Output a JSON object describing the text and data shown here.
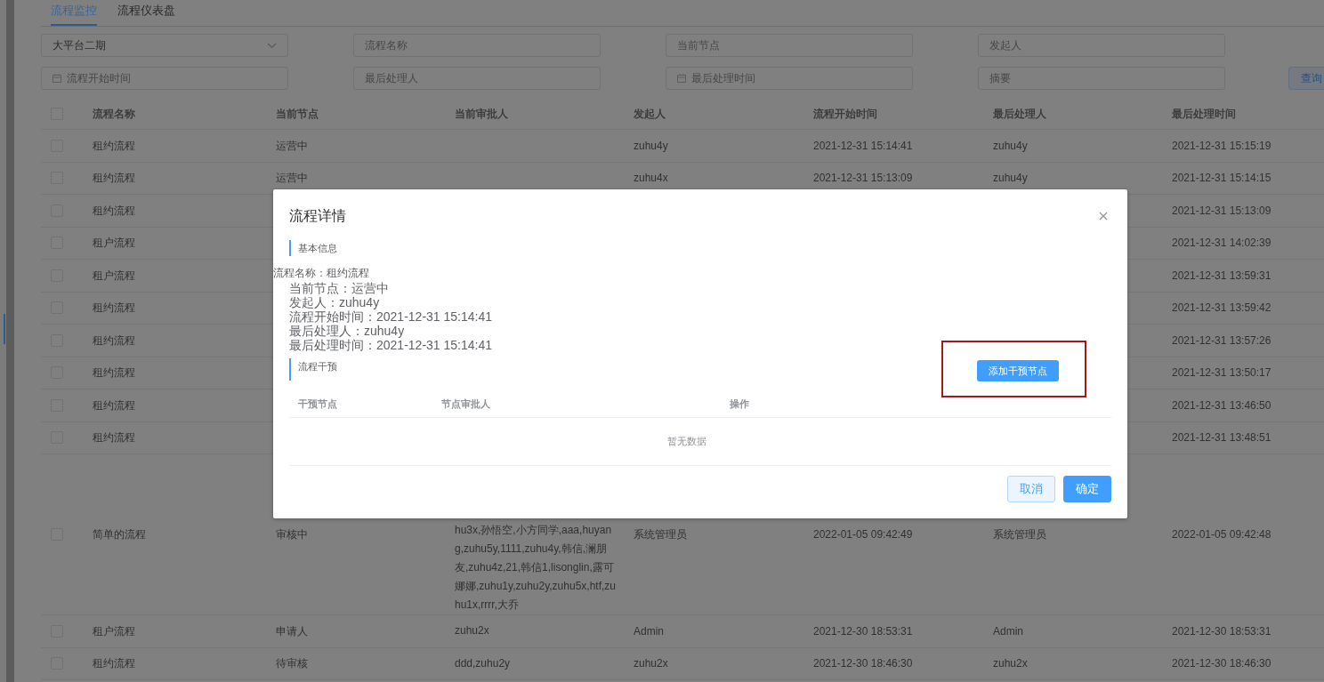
{
  "tabs": [
    {
      "label": "流程监控",
      "selected": true
    },
    {
      "label": "流程仪表盘",
      "selected": false
    }
  ],
  "filters": [
    {
      "kind": "select",
      "value": "大平台二期"
    },
    {
      "kind": "text",
      "placeholder": "流程名称"
    },
    {
      "kind": "text",
      "placeholder": "当前节点"
    },
    {
      "kind": "text",
      "placeholder": "发起人"
    },
    {
      "kind": "date",
      "placeholder": "流程开始时间"
    },
    {
      "kind": "text",
      "placeholder": "最后处理人"
    },
    {
      "kind": "date",
      "placeholder": "最后处理时间"
    },
    {
      "kind": "text",
      "placeholder": "摘要"
    }
  ],
  "query_button": "查询",
  "table": {
    "all_checked": false,
    "columns": [
      "流程名称",
      "当前节点",
      "当前审批人",
      "发起人",
      "流程开始时间",
      "最后处理人",
      "最后处理时间"
    ],
    "rows": [
      {
        "kind": "single",
        "checked": false,
        "cells": {
          "name": "租约流程",
          "node": "运营中",
          "initiator": "zuhu4y",
          "start_time": "2021-12-31 15:14:41",
          "last_handler": "zuhu4y",
          "last_time": "2021-12-31 15:15:19"
        }
      },
      {
        "kind": "single",
        "checked": false,
        "cells": {
          "name": "租约流程",
          "node": "运营中",
          "initiator": "zuhu4x",
          "start_time": "2021-12-31 15:13:09",
          "last_handler": "zuhu4y",
          "last_time": "2021-12-31 15:14:15"
        }
      },
      {
        "kind": "single",
        "checked": false,
        "cells": {
          "name": "租约流程",
          "last_time": "2021-12-31 15:13:09"
        }
      },
      {
        "kind": "single",
        "checked": false,
        "cells": {
          "name": "租户流程",
          "last_time": "2021-12-31 14:02:39"
        }
      },
      {
        "kind": "single",
        "checked": false,
        "cells": {
          "name": "租户流程",
          "last_time": "2021-12-31 13:59:31"
        }
      },
      {
        "kind": "single",
        "checked": false,
        "cells": {
          "name": "租约流程",
          "last_time": "2021-12-31 13:59:42"
        }
      },
      {
        "kind": "single",
        "checked": false,
        "cells": {
          "name": "租约流程",
          "last_time": "2021-12-31 13:57:26"
        }
      },
      {
        "kind": "single",
        "checked": false,
        "cells": {
          "name": "租约流程",
          "last_time": "2021-12-31 13:50:17"
        }
      },
      {
        "kind": "single",
        "checked": false,
        "cells": {
          "name": "租约流程",
          "last_time": "2021-12-31 13:46:50"
        }
      },
      {
        "kind": "single",
        "checked": false,
        "cells": {
          "name": "租约流程",
          "last_time": "2021-12-31 13:48:51"
        }
      },
      {
        "kind": "multiline",
        "checked": false,
        "cells": {
          "name": "简单的流程",
          "node": "审核中",
          "approver": "hu3x,孙悟空,小方同学,aaa,huyang,zuhu5y,1111,zuhu4y,韩信,澜朋友,zuhu4z,21,韩信1,lisonglin,露可娜娜,zuhu1y,zuhu2y,zuhu5x,htf,zuhu1x,rrrr,大乔",
          "initiator": "系统管理员",
          "start_time": "2022-01-05 09:42:49",
          "last_handler": "系统管理员",
          "last_time": "2022-01-05 09:42:48"
        }
      },
      {
        "kind": "single",
        "checked": false,
        "cells": {
          "name": "租户流程",
          "node": "申请人",
          "approver": "zuhu2x",
          "initiator": "Admin",
          "start_time": "2021-12-30 18:53:31",
          "last_handler": "Admin",
          "last_time": "2021-12-30 18:53:31"
        }
      },
      {
        "kind": "single",
        "checked": false,
        "cells": {
          "name": "租约流程",
          "node": "待审核",
          "approver": "ddd,zuhu2y",
          "initiator": "zuhu2x",
          "start_time": "2021-12-30 18:46:30",
          "last_handler": "zuhu2x",
          "last_time": "2021-12-30 18:46:30"
        }
      }
    ]
  },
  "dialog": {
    "title": "流程详情",
    "basic_info": {
      "heading": "基本信息",
      "lines": [
        {
          "kind": "caption",
          "text": "流程名称：租约流程"
        },
        {
          "kind": "field",
          "text": "当前节点：运营中"
        },
        {
          "kind": "field",
          "text": "发起人：zuhu4y"
        },
        {
          "kind": "field",
          "text": "流程开始时间：2021-12-31 15:14:41"
        },
        {
          "kind": "field",
          "text": "最后处理人：zuhu4y"
        },
        {
          "kind": "field",
          "text": "最后处理时间：2021-12-31 15:14:41"
        }
      ]
    },
    "intervention": {
      "heading": "流程干预",
      "add_button": "添加干预节点",
      "columns": [
        "干预节点",
        "节点审批人",
        "操作"
      ],
      "empty_text": "暂无数据"
    },
    "buttons": [
      {
        "kind": "secondary",
        "label": "取消"
      },
      {
        "kind": "primary",
        "label": "确定"
      }
    ]
  }
}
